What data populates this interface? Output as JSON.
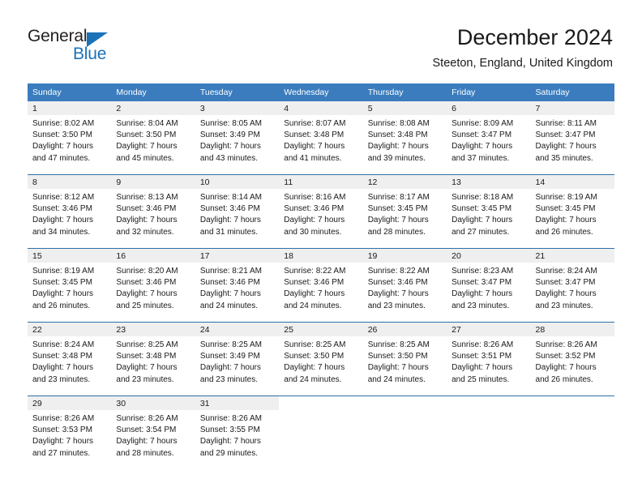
{
  "brand": {
    "name_top": "General",
    "name_bottom": "Blue"
  },
  "header": {
    "title": "December 2024",
    "subtitle": "Steeton, England, United Kingdom"
  },
  "colors": {
    "header_blue": "#3a7cbe",
    "row_divider": "#2f6fa8",
    "daynum_band": "#efefef",
    "brand_blue": "#1b72b8",
    "text": "#1a1a1a"
  },
  "weekday_headers": [
    "Sunday",
    "Monday",
    "Tuesday",
    "Wednesday",
    "Thursday",
    "Friday",
    "Saturday"
  ],
  "weeks": [
    [
      {
        "day": "1",
        "sunrise": "Sunrise: 8:02 AM",
        "sunset": "Sunset: 3:50 PM",
        "daylight1": "Daylight: 7 hours",
        "daylight2": "and 47 minutes."
      },
      {
        "day": "2",
        "sunrise": "Sunrise: 8:04 AM",
        "sunset": "Sunset: 3:50 PM",
        "daylight1": "Daylight: 7 hours",
        "daylight2": "and 45 minutes."
      },
      {
        "day": "3",
        "sunrise": "Sunrise: 8:05 AM",
        "sunset": "Sunset: 3:49 PM",
        "daylight1": "Daylight: 7 hours",
        "daylight2": "and 43 minutes."
      },
      {
        "day": "4",
        "sunrise": "Sunrise: 8:07 AM",
        "sunset": "Sunset: 3:48 PM",
        "daylight1": "Daylight: 7 hours",
        "daylight2": "and 41 minutes."
      },
      {
        "day": "5",
        "sunrise": "Sunrise: 8:08 AM",
        "sunset": "Sunset: 3:48 PM",
        "daylight1": "Daylight: 7 hours",
        "daylight2": "and 39 minutes."
      },
      {
        "day": "6",
        "sunrise": "Sunrise: 8:09 AM",
        "sunset": "Sunset: 3:47 PM",
        "daylight1": "Daylight: 7 hours",
        "daylight2": "and 37 minutes."
      },
      {
        "day": "7",
        "sunrise": "Sunrise: 8:11 AM",
        "sunset": "Sunset: 3:47 PM",
        "daylight1": "Daylight: 7 hours",
        "daylight2": "and 35 minutes."
      }
    ],
    [
      {
        "day": "8",
        "sunrise": "Sunrise: 8:12 AM",
        "sunset": "Sunset: 3:46 PM",
        "daylight1": "Daylight: 7 hours",
        "daylight2": "and 34 minutes."
      },
      {
        "day": "9",
        "sunrise": "Sunrise: 8:13 AM",
        "sunset": "Sunset: 3:46 PM",
        "daylight1": "Daylight: 7 hours",
        "daylight2": "and 32 minutes."
      },
      {
        "day": "10",
        "sunrise": "Sunrise: 8:14 AM",
        "sunset": "Sunset: 3:46 PM",
        "daylight1": "Daylight: 7 hours",
        "daylight2": "and 31 minutes."
      },
      {
        "day": "11",
        "sunrise": "Sunrise: 8:16 AM",
        "sunset": "Sunset: 3:46 PM",
        "daylight1": "Daylight: 7 hours",
        "daylight2": "and 30 minutes."
      },
      {
        "day": "12",
        "sunrise": "Sunrise: 8:17 AM",
        "sunset": "Sunset: 3:45 PM",
        "daylight1": "Daylight: 7 hours",
        "daylight2": "and 28 minutes."
      },
      {
        "day": "13",
        "sunrise": "Sunrise: 8:18 AM",
        "sunset": "Sunset: 3:45 PM",
        "daylight1": "Daylight: 7 hours",
        "daylight2": "and 27 minutes."
      },
      {
        "day": "14",
        "sunrise": "Sunrise: 8:19 AM",
        "sunset": "Sunset: 3:45 PM",
        "daylight1": "Daylight: 7 hours",
        "daylight2": "and 26 minutes."
      }
    ],
    [
      {
        "day": "15",
        "sunrise": "Sunrise: 8:19 AM",
        "sunset": "Sunset: 3:45 PM",
        "daylight1": "Daylight: 7 hours",
        "daylight2": "and 26 minutes."
      },
      {
        "day": "16",
        "sunrise": "Sunrise: 8:20 AM",
        "sunset": "Sunset: 3:46 PM",
        "daylight1": "Daylight: 7 hours",
        "daylight2": "and 25 minutes."
      },
      {
        "day": "17",
        "sunrise": "Sunrise: 8:21 AM",
        "sunset": "Sunset: 3:46 PM",
        "daylight1": "Daylight: 7 hours",
        "daylight2": "and 24 minutes."
      },
      {
        "day": "18",
        "sunrise": "Sunrise: 8:22 AM",
        "sunset": "Sunset: 3:46 PM",
        "daylight1": "Daylight: 7 hours",
        "daylight2": "and 24 minutes."
      },
      {
        "day": "19",
        "sunrise": "Sunrise: 8:22 AM",
        "sunset": "Sunset: 3:46 PM",
        "daylight1": "Daylight: 7 hours",
        "daylight2": "and 23 minutes."
      },
      {
        "day": "20",
        "sunrise": "Sunrise: 8:23 AM",
        "sunset": "Sunset: 3:47 PM",
        "daylight1": "Daylight: 7 hours",
        "daylight2": "and 23 minutes."
      },
      {
        "day": "21",
        "sunrise": "Sunrise: 8:24 AM",
        "sunset": "Sunset: 3:47 PM",
        "daylight1": "Daylight: 7 hours",
        "daylight2": "and 23 minutes."
      }
    ],
    [
      {
        "day": "22",
        "sunrise": "Sunrise: 8:24 AM",
        "sunset": "Sunset: 3:48 PM",
        "daylight1": "Daylight: 7 hours",
        "daylight2": "and 23 minutes."
      },
      {
        "day": "23",
        "sunrise": "Sunrise: 8:25 AM",
        "sunset": "Sunset: 3:48 PM",
        "daylight1": "Daylight: 7 hours",
        "daylight2": "and 23 minutes."
      },
      {
        "day": "24",
        "sunrise": "Sunrise: 8:25 AM",
        "sunset": "Sunset: 3:49 PM",
        "daylight1": "Daylight: 7 hours",
        "daylight2": "and 23 minutes."
      },
      {
        "day": "25",
        "sunrise": "Sunrise: 8:25 AM",
        "sunset": "Sunset: 3:50 PM",
        "daylight1": "Daylight: 7 hours",
        "daylight2": "and 24 minutes."
      },
      {
        "day": "26",
        "sunrise": "Sunrise: 8:25 AM",
        "sunset": "Sunset: 3:50 PM",
        "daylight1": "Daylight: 7 hours",
        "daylight2": "and 24 minutes."
      },
      {
        "day": "27",
        "sunrise": "Sunrise: 8:26 AM",
        "sunset": "Sunset: 3:51 PM",
        "daylight1": "Daylight: 7 hours",
        "daylight2": "and 25 minutes."
      },
      {
        "day": "28",
        "sunrise": "Sunrise: 8:26 AM",
        "sunset": "Sunset: 3:52 PM",
        "daylight1": "Daylight: 7 hours",
        "daylight2": "and 26 minutes."
      }
    ],
    [
      {
        "day": "29",
        "sunrise": "Sunrise: 8:26 AM",
        "sunset": "Sunset: 3:53 PM",
        "daylight1": "Daylight: 7 hours",
        "daylight2": "and 27 minutes."
      },
      {
        "day": "30",
        "sunrise": "Sunrise: 8:26 AM",
        "sunset": "Sunset: 3:54 PM",
        "daylight1": "Daylight: 7 hours",
        "daylight2": "and 28 minutes."
      },
      {
        "day": "31",
        "sunrise": "Sunrise: 8:26 AM",
        "sunset": "Sunset: 3:55 PM",
        "daylight1": "Daylight: 7 hours",
        "daylight2": "and 29 minutes."
      },
      null,
      null,
      null,
      null
    ]
  ]
}
